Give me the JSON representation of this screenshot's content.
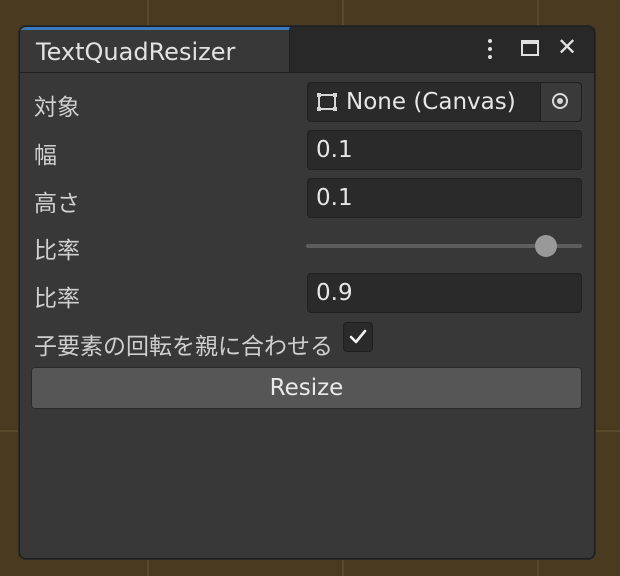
{
  "window": {
    "tab_title": "TextQuadResizer"
  },
  "titlebar_icons": [
    "more-vertical-icon",
    "maximize-icon",
    "close-icon"
  ],
  "fields": {
    "target": {
      "label": "対象",
      "value": "None (Canvas)"
    },
    "width": {
      "label": "幅",
      "value": "0.1"
    },
    "height": {
      "label": "高さ",
      "value": "0.1"
    },
    "ratio_slider": {
      "label": "比率",
      "value": 0.9
    },
    "ratio": {
      "label": "比率",
      "value": "0.9"
    },
    "match_rotation": {
      "label": "子要素の回転を親に合わせる",
      "checked": true
    }
  },
  "resize_button": {
    "label": "Resize"
  },
  "colors": {
    "tab_accent": "#3a79bb",
    "panel_bg": "#383838",
    "field_bg": "#2a2a2a",
    "button_bg": "#565656",
    "outer_bg": "#4a3a1f"
  },
  "close_glyph": "✕"
}
